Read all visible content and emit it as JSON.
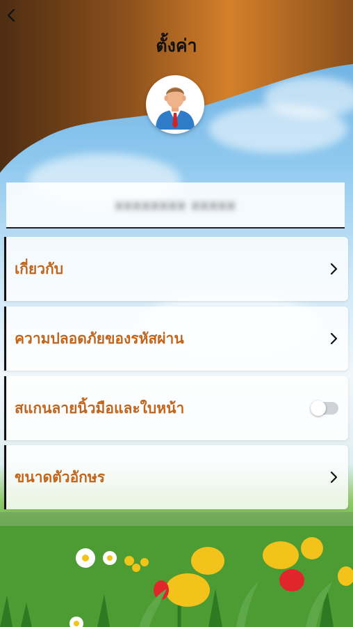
{
  "header": {
    "title": "ตั้งค่า",
    "back_icon": "chevron-left-icon"
  },
  "profile": {
    "avatar_icon": "user-avatar-icon",
    "username": "xxxxxxxx xxxxx"
  },
  "menu": {
    "items": [
      {
        "label": "เกี่ยวกับ",
        "control": "chevron-right-icon"
      },
      {
        "label": "ความปลอดภัยของรหัสผ่าน",
        "control": "chevron-right-icon"
      },
      {
        "label": "สแกนลายนิ้วมือและใบหน้า",
        "control": "toggle"
      },
      {
        "label": "ขนาดตัวอักษร",
        "control": "chevron-right-icon"
      }
    ],
    "biometric_enabled": false
  },
  "colors": {
    "accent": "#c2651c",
    "header_brown_dark": "#5a3414",
    "header_orange": "#d4802a"
  }
}
